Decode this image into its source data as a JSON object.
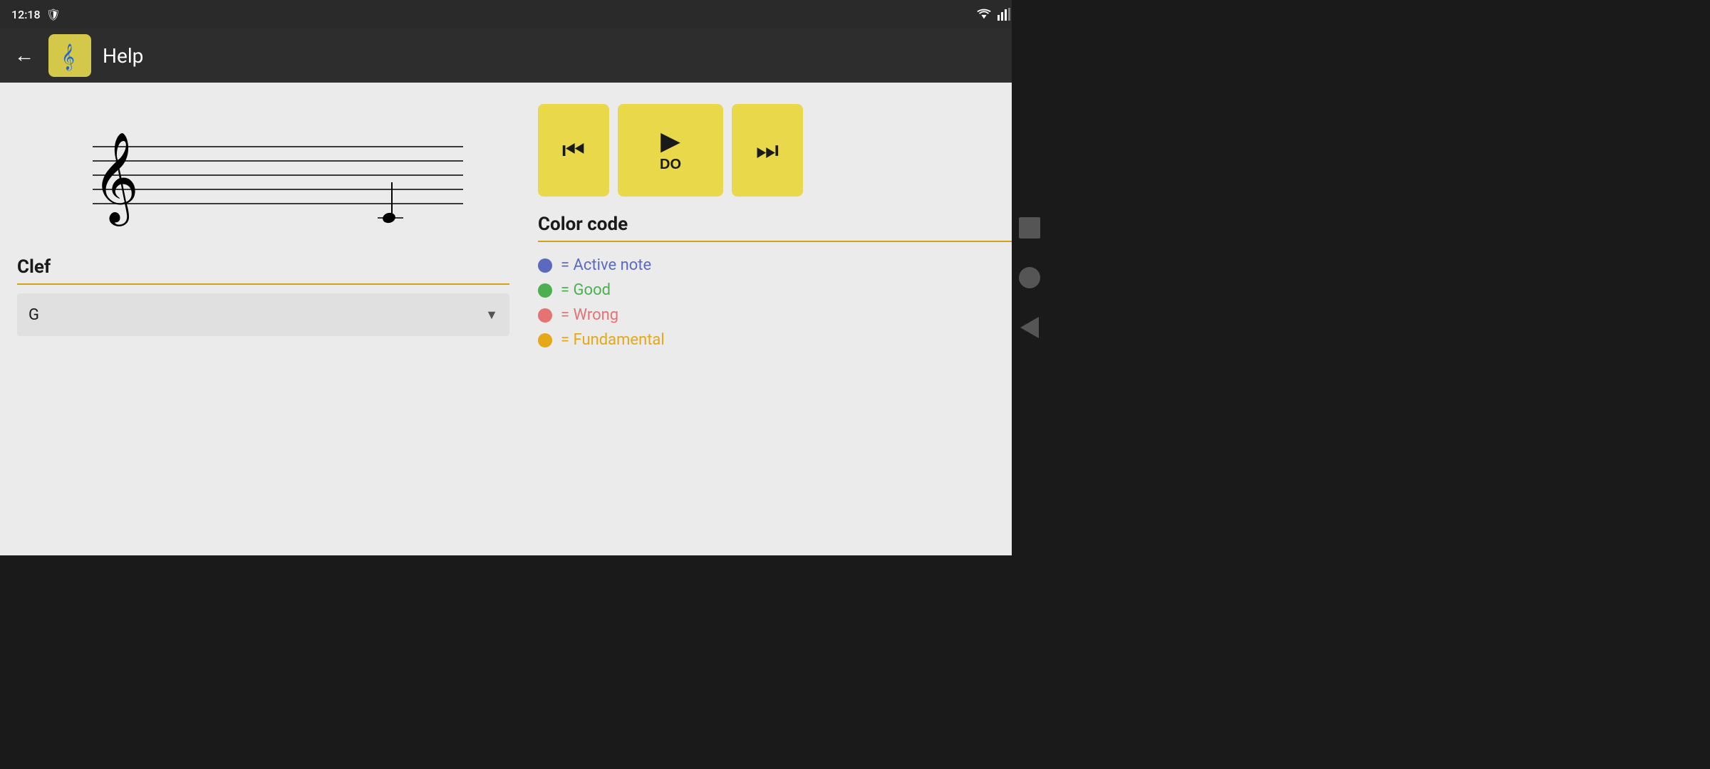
{
  "statusBar": {
    "time": "12:18",
    "icons": [
      "shield-icon",
      "wifi-icon",
      "signal-icon",
      "battery-icon"
    ]
  },
  "appBar": {
    "backLabel": "←",
    "title": "Help",
    "settingsLabel": "⚙"
  },
  "playbackControls": {
    "prevLabel": "⏮",
    "playLabel": "▶",
    "playNote": "DO",
    "nextLabel": "⏭"
  },
  "clefSection": {
    "title": "Clef",
    "selectedValue": "G",
    "dropdownArrow": "▼"
  },
  "colorCodeSection": {
    "title": "Color code",
    "items": [
      {
        "label": "= Active note",
        "color": "#5b6abf",
        "dotColor": "#5b6abf"
      },
      {
        "label": "= Good",
        "color": "#4caf50",
        "dotColor": "#4caf50"
      },
      {
        "label": "= Wrong",
        "color": "#e57373",
        "dotColor": "#e57373"
      },
      {
        "label": "= Fundamental",
        "color": "#e6a817",
        "dotColor": "#e6a817"
      }
    ]
  }
}
